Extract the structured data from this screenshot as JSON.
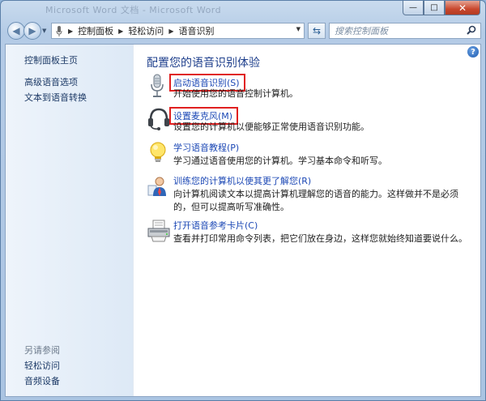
{
  "window": {
    "title": "Microsoft Word 文档 - Microsoft Word"
  },
  "titlebar": {
    "minimize": "—",
    "maximize": "□",
    "close": "✕"
  },
  "address": {
    "crumbs": [
      "控制面板",
      "轻松访问",
      "语音识别"
    ]
  },
  "search": {
    "placeholder": "搜索控制面板"
  },
  "sidebar": {
    "home": "控制面板主页",
    "links": [
      "高级语音选项",
      "文本到语音转换"
    ],
    "see_also_title": "另请参阅",
    "see_also": [
      "轻松访问",
      "音频设备"
    ]
  },
  "main": {
    "title": "配置您的语音识别体验",
    "tasks": [
      {
        "link": "启动语音识别(S)",
        "desc": "开始使用您的语音控制计算机。",
        "icon": "microphone-icon",
        "highlighted": true
      },
      {
        "link": "设置麦克风(M)",
        "desc": "设置您的计算机以便能够正常使用语音识别功能。",
        "icon": "headset-icon",
        "highlighted": true
      },
      {
        "link": "学习语音教程(P)",
        "desc": "学习通过语音使用您的计算机。学习基本命令和听写。",
        "icon": "lightbulb-icon",
        "highlighted": false
      },
      {
        "link": "训练您的计算机以使其更了解您(R)",
        "desc": "向计算机阅读文本以提高计算机理解您的语音的能力。这样做并不是必须的，但可以提高听写准确性。",
        "icon": "user-training-icon",
        "highlighted": false
      },
      {
        "link": "打开语音参考卡片(C)",
        "desc": "查看并打印常用命令列表，把它们放在身边，这样您就始终知道要说什么。",
        "icon": "printer-icon",
        "highlighted": false
      }
    ]
  },
  "colors": {
    "link": "#1c48b5",
    "title": "#1e3f8c",
    "highlight_box": "#e02020"
  }
}
